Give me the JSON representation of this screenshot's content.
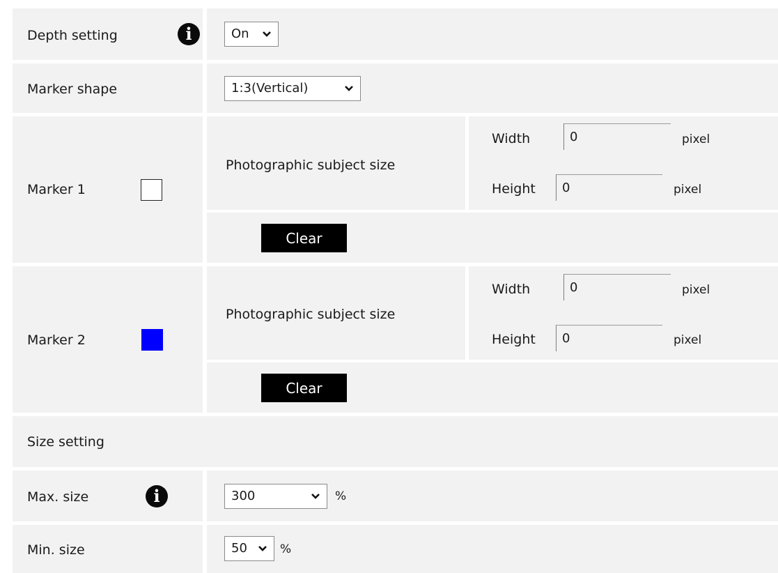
{
  "depth_setting": {
    "label": "Depth setting",
    "icon": "info-icon",
    "select_value": "On"
  },
  "marker_shape": {
    "label": "Marker shape",
    "select_value": "1:3(Vertical)"
  },
  "marker1": {
    "label": "Marker 1",
    "color": "#ffffff",
    "subject_size_label": "Photographic subject size",
    "width_label": "Width",
    "width_value": "0",
    "width_unit": "pixel",
    "height_label": "Height",
    "height_value": "0",
    "height_unit": "pixel",
    "clear_label": "Clear"
  },
  "marker2": {
    "label": "Marker 2",
    "color": "#0000ff",
    "subject_size_label": "Photographic subject size",
    "width_label": "Width",
    "width_value": "0",
    "width_unit": "pixel",
    "height_label": "Height",
    "height_value": "0",
    "height_unit": "pixel",
    "clear_label": "Clear"
  },
  "size_setting": {
    "label": "Size setting"
  },
  "max_size": {
    "label": "Max. size",
    "icon": "info-icon",
    "select_value": "300",
    "unit": "%"
  },
  "min_size": {
    "label": "Min. size",
    "select_value": "50",
    "unit": "%"
  }
}
